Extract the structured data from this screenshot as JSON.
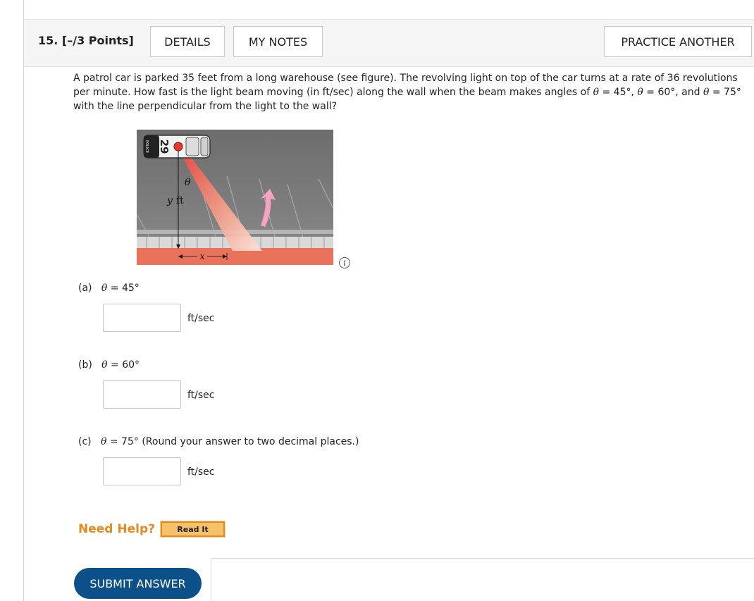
{
  "question": {
    "number_points": "15. [–/3 Points]",
    "tabs": {
      "details": "DETAILS",
      "my_notes": "MY NOTES",
      "practice": "PRACTICE ANOTHER"
    },
    "prompt": {
      "t1": "A patrol car is parked 35 feet from a long warehouse (see figure). The revolving light on top of the car turns at a rate of 36 revolutions per minute. How fast is the light beam moving (in ft/sec) along the wall when the beam makes angles of ",
      "th1": "θ",
      "t2": " = 45°, ",
      "th2": "θ",
      "t3": " = 60°, and ",
      "th3": "θ",
      "t4": " = 75° with the line perpendicular from the light to the wall?"
    }
  },
  "figure": {
    "car_number": "29",
    "car_side_text": "POLICE",
    "theta_label": "θ",
    "y_label_var": "y",
    "y_label_unit": "ft",
    "x_label": "x",
    "info_icon_glyph": "i",
    "colors": {
      "background": "#7a7a7a",
      "wall": "#e8735a",
      "beam": "#f7c0b3",
      "arrow": "#f5a3c0",
      "lines": "#cfcfcf"
    }
  },
  "parts": [
    {
      "letter": "(a)",
      "theta": "θ",
      "eq": " = 45°",
      "note": "",
      "unit": "ft/sec",
      "value": ""
    },
    {
      "letter": "(b)",
      "theta": "θ",
      "eq": " = 60°",
      "note": "",
      "unit": "ft/sec",
      "value": ""
    },
    {
      "letter": "(c)",
      "theta": "θ",
      "eq": " = 75°",
      "note": " (Round your answer to two decimal places.)",
      "unit": "ft/sec",
      "value": ""
    }
  ],
  "help": {
    "label": "Need Help?",
    "read_it": "Read It"
  },
  "submit_label": "SUBMIT ANSWER"
}
